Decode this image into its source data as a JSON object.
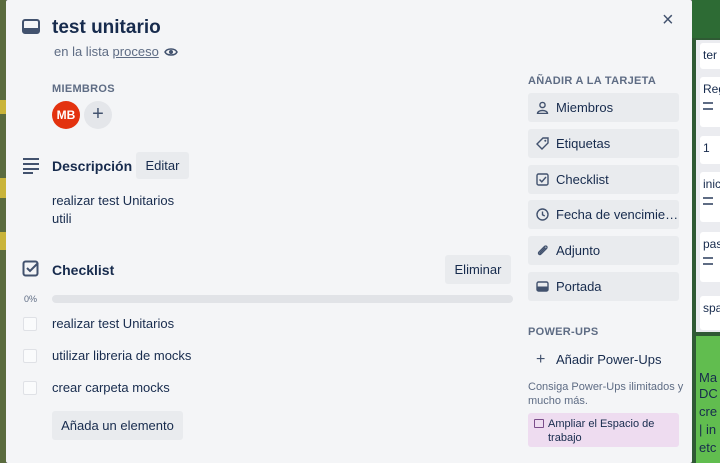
{
  "background": {
    "right_cards": [
      "ter",
      "Reg",
      "1",
      "inic",
      "pas",
      "spa"
    ],
    "right_green_lines": [
      "Ma",
      "DC",
      "cre",
      "| in",
      "etc"
    ]
  },
  "card": {
    "title": "test unitario",
    "in_list_prefix": "en la lista",
    "list_name": "proceso",
    "close_label": "×"
  },
  "members": {
    "label": "MIEMBROS",
    "avatar_initials": "MB",
    "avatar_color": "#e3320f",
    "add_label": "+"
  },
  "description": {
    "title": "Descripción",
    "edit_label": "Editar",
    "lines": [
      "realizar test Unitarios",
      "utili"
    ]
  },
  "checklist": {
    "title": "Checklist",
    "delete_label": "Eliminar",
    "progress_text": "0%",
    "progress": 0,
    "items": [
      {
        "text": "realizar test Unitarios",
        "checked": false
      },
      {
        "text": "utilizar libreria de mocks",
        "checked": false
      },
      {
        "text": "crear carpeta mocks",
        "checked": false
      }
    ],
    "add_item_label": "Añada un elemento"
  },
  "sidebar": {
    "add_to_card_label": "AÑADIR A LA TARJETA",
    "buttons": [
      {
        "label": "Miembros",
        "icon": "person-icon"
      },
      {
        "label": "Etiquetas",
        "icon": "tag-icon"
      },
      {
        "label": "Checklist",
        "icon": "checklist-icon"
      },
      {
        "label": "Fecha de vencimiento",
        "icon": "clock-icon"
      },
      {
        "label": "Adjunto",
        "icon": "paperclip-icon"
      },
      {
        "label": "Portada",
        "icon": "card-cover-icon"
      }
    ],
    "powerups_label": "POWER-UPS",
    "add_powerups_label": "Añadir Power-Ups",
    "powerups_note": "Consiga Power-Ups ilimitados y mucho más.",
    "upgrade_label": "Ampliar el Espacio de trabajo"
  },
  "colors": {
    "modal_bg": "#f4f5f7",
    "button_bg": "#e9ebee",
    "upgrade_bg": "#eedcf0",
    "text": "#172b4d",
    "muted": "#5e6c84"
  }
}
